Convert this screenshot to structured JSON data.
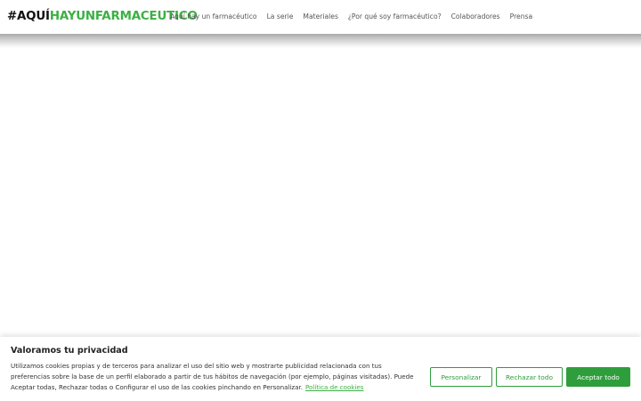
{
  "site": {
    "logo_prefix": "#AQUÍ",
    "logo_highlight": "HAYUNFARMACEUTICO"
  },
  "nav": {
    "items": [
      {
        "label": "Aquí hay un farmacéutico"
      },
      {
        "label": "La serie"
      },
      {
        "label": "Materiales"
      },
      {
        "label": "¿Por qué soy farmacéutico?"
      },
      {
        "label": "Colaboradores"
      },
      {
        "label": "Prensa"
      }
    ]
  },
  "cookie": {
    "title": "Valoramos tu privacidad",
    "text": "Utilizamos cookies propias y de terceros para analizar el uso del sitio web y mostrarte publicidad relacionada con tus preferencias sobre la base de un perfil elaborado a partir de tus hábitos de navegación (por ejemplo, páginas visitadas). Puede Aceptar todas, Rechazar todas o Configurar el uso de las cookies pinchando en Personalizar.",
    "policy_link": "Política de cookies",
    "customize_label": "Personalizar",
    "reject_label": "Rechazar todo",
    "accept_label": "Aceptar todo"
  },
  "colors": {
    "brand_green": "#3cb043",
    "button_green": "#2e9e3c"
  }
}
